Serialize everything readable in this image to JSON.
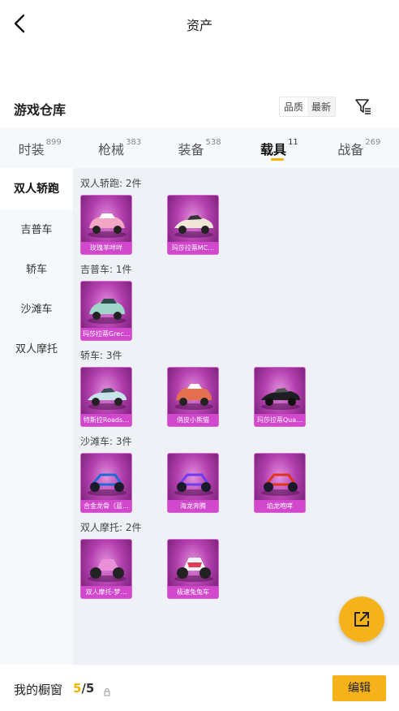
{
  "header": {
    "title": "资产",
    "back_icon": "chevron-left-icon"
  },
  "warehouse": {
    "title": "游戏仓库",
    "sort_options": [
      "品质",
      "最新"
    ],
    "filter_icon": "filter-icon"
  },
  "tabs": [
    {
      "label": "时装",
      "count": "899"
    },
    {
      "label": "枪械",
      "count": "383"
    },
    {
      "label": "装备",
      "count": "538"
    },
    {
      "label": "载具",
      "count": "11",
      "active": true
    },
    {
      "label": "战备",
      "count": "269"
    }
  ],
  "sidebar": {
    "items": [
      "双人轿跑",
      "吉普车",
      "轿车",
      "沙滩车",
      "双人摩托"
    ]
  },
  "groups": [
    {
      "title": "双人轿跑: 2件",
      "items": [
        "玫瑰羊咩咩",
        "玛莎拉蒂MC…"
      ]
    },
    {
      "title": "吉普车: 1件",
      "items": [
        "玛莎拉蒂Grec…"
      ]
    },
    {
      "title": "轿车: 3件",
      "items": [
        "特斯拉Roads…",
        "俏皮小熊猫",
        "玛莎拉蒂Qua…"
      ]
    },
    {
      "title": "沙滩车: 3件",
      "items": [
        "合金龙骨（蓝…",
        "海龙奔腾",
        "焰龙咆哮"
      ]
    },
    {
      "title": "双人摩托: 2件",
      "items": [
        "双人摩托-梦…",
        "极速兔兔车"
      ]
    }
  ],
  "bottom": {
    "label": "我的橱窗",
    "count_current": "5",
    "count_sep": "/",
    "count_total": "5",
    "edit_label": "编辑"
  },
  "colors": {
    "accent": "#f4b400",
    "card_purple": "#b23fae",
    "fab": "#f6b21b"
  }
}
